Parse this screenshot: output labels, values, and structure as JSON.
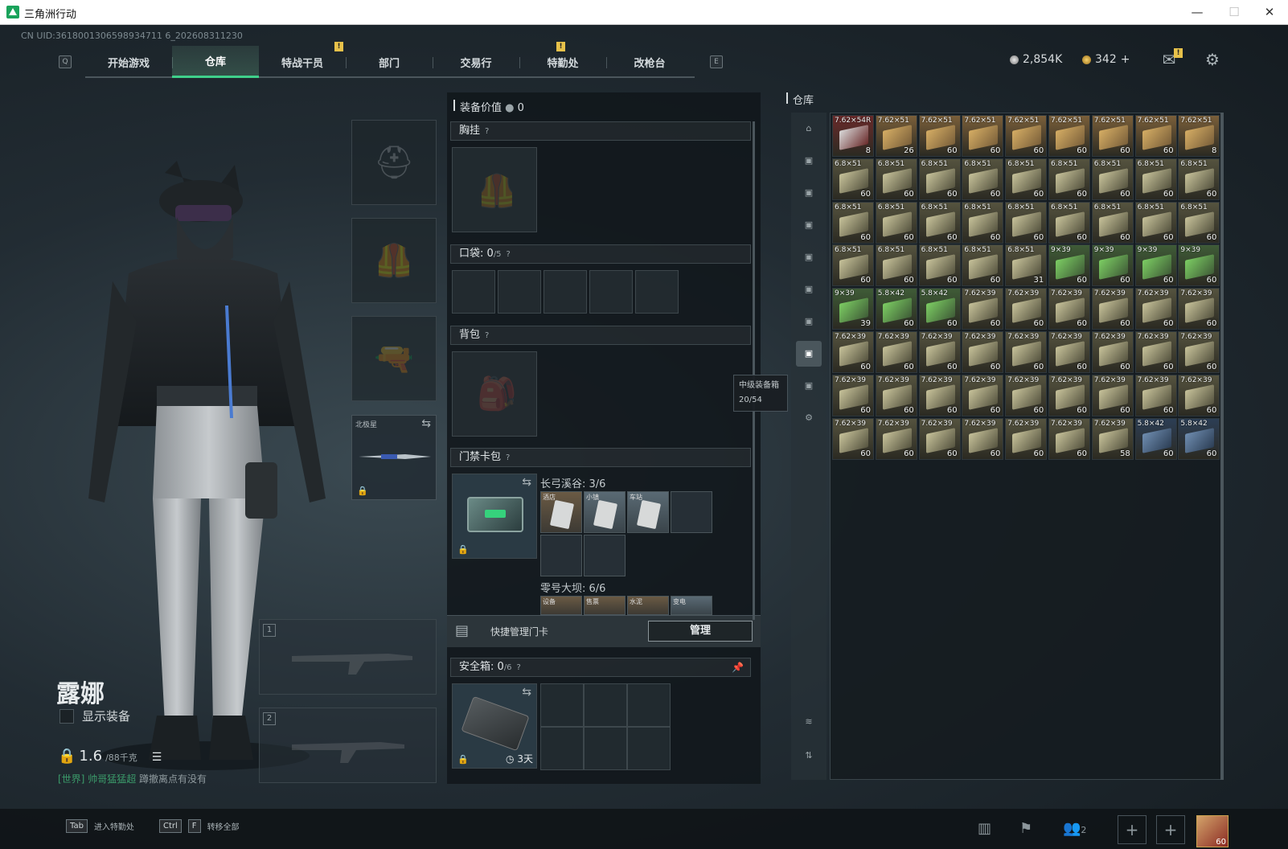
{
  "window": {
    "title": "三角洲行动",
    "minimize": "—",
    "maximize": "☐",
    "close": "✕"
  },
  "uid_text": "CN UID:3618001306598934711 6_202608311230",
  "nav": {
    "key_left": "Q",
    "key_right": "E",
    "tabs": [
      {
        "label": "开始游戏",
        "notif": ""
      },
      {
        "label": "仓库",
        "notif": ""
      },
      {
        "label": "特战干员",
        "notif": "!"
      },
      {
        "label": "部门",
        "notif": ""
      },
      {
        "label": "交易行",
        "notif": ""
      },
      {
        "label": "特勤处",
        "notif": "!"
      },
      {
        "label": "改枪台",
        "notif": ""
      }
    ],
    "active_tab": "仓库"
  },
  "currency": {
    "silver": "2,854K",
    "gold": "342",
    "add": "+",
    "mail_notif": "!"
  },
  "character": {
    "name": "露娜",
    "show_equipment": "显示装备",
    "weight": "1.6",
    "weight_max": "/88千克"
  },
  "chat": {
    "channel": "[世界]",
    "sender": "帅哥猛猛超",
    "message": "蹲撤离点有没有"
  },
  "equip": {
    "melee_label": "北极星",
    "weapon_slot_1": "1",
    "weapon_slot_2": "2"
  },
  "loadout": {
    "value_label": "装备价值",
    "value": "0",
    "chest_rig": "胸挂",
    "pockets": "口袋:",
    "pockets_count": "0",
    "pockets_max": "/5",
    "backpack": "背包",
    "keycard_case": "门禁卡包",
    "zone1_name": "长弓溪谷:",
    "zone1_count": "3/6",
    "zone1_cards": [
      "酒店",
      "小镇",
      "车站"
    ],
    "zone2_name": "零号大坝:",
    "zone2_count": "6/6",
    "zone2_cards": [
      "设备",
      "售票",
      "水泥",
      "变电"
    ],
    "quick_manage": "快捷管理门卡",
    "manage_btn": "管理",
    "safe_box": "安全箱:",
    "safe_count": "0",
    "safe_max": "/6",
    "safe_timer": "3天",
    "help": "?"
  },
  "tooltip": {
    "line1": "中级装备箱",
    "line2": "20/54"
  },
  "warehouse": {
    "title": "仓库",
    "items": [
      {
        "n": "7.62×54R",
        "c": "8",
        "t": "grey"
      },
      {
        "n": "7.62×51",
        "c": "26",
        "t": "tan"
      },
      {
        "n": "7.62×51",
        "c": "60",
        "t": "tan"
      },
      {
        "n": "7.62×51",
        "c": "60",
        "t": "tan"
      },
      {
        "n": "7.62×51",
        "c": "60",
        "t": "tan"
      },
      {
        "n": "7.62×51",
        "c": "60",
        "t": "tan"
      },
      {
        "n": "7.62×51",
        "c": "60",
        "t": "tan"
      },
      {
        "n": "7.62×51",
        "c": "60",
        "t": "tan"
      },
      {
        "n": "7.62×51",
        "c": "8",
        "t": "tan"
      },
      {
        "n": "6.8×51",
        "c": "60",
        "t": "olive"
      },
      {
        "n": "6.8×51",
        "c": "60",
        "t": "olive"
      },
      {
        "n": "6.8×51",
        "c": "60",
        "t": "olive"
      },
      {
        "n": "6.8×51",
        "c": "60",
        "t": "olive"
      },
      {
        "n": "6.8×51",
        "c": "60",
        "t": "olive"
      },
      {
        "n": "6.8×51",
        "c": "60",
        "t": "olive"
      },
      {
        "n": "6.8×51",
        "c": "60",
        "t": "olive"
      },
      {
        "n": "6.8×51",
        "c": "60",
        "t": "olive"
      },
      {
        "n": "6.8×51",
        "c": "60",
        "t": "olive"
      },
      {
        "n": "6.8×51",
        "c": "60",
        "t": "olive"
      },
      {
        "n": "6.8×51",
        "c": "60",
        "t": "olive"
      },
      {
        "n": "6.8×51",
        "c": "60",
        "t": "olive"
      },
      {
        "n": "6.8×51",
        "c": "60",
        "t": "olive"
      },
      {
        "n": "6.8×51",
        "c": "60",
        "t": "olive"
      },
      {
        "n": "6.8×51",
        "c": "60",
        "t": "olive"
      },
      {
        "n": "6.8×51",
        "c": "60",
        "t": "olive"
      },
      {
        "n": "6.8×51",
        "c": "60",
        "t": "olive"
      },
      {
        "n": "6.8×51",
        "c": "60",
        "t": "olive"
      },
      {
        "n": "6.8×51",
        "c": "60",
        "t": "olive"
      },
      {
        "n": "6.8×51",
        "c": "60",
        "t": "olive"
      },
      {
        "n": "6.8×51",
        "c": "60",
        "t": "olive"
      },
      {
        "n": "6.8×51",
        "c": "60",
        "t": "olive"
      },
      {
        "n": "6.8×51",
        "c": "31",
        "t": "olive"
      },
      {
        "n": "9×39",
        "c": "60",
        "t": "green"
      },
      {
        "n": "9×39",
        "c": "60",
        "t": "green"
      },
      {
        "n": "9×39",
        "c": "60",
        "t": "green"
      },
      {
        "n": "9×39",
        "c": "60",
        "t": "green"
      },
      {
        "n": "9×39",
        "c": "39",
        "t": "green"
      },
      {
        "n": "5.8×42",
        "c": "60",
        "t": "green"
      },
      {
        "n": "5.8×42",
        "c": "60",
        "t": "green"
      },
      {
        "n": "7.62×39",
        "c": "60",
        "t": "olive"
      },
      {
        "n": "7.62×39",
        "c": "60",
        "t": "olive"
      },
      {
        "n": "7.62×39",
        "c": "60",
        "t": "olive"
      },
      {
        "n": "7.62×39",
        "c": "60",
        "t": "olive"
      },
      {
        "n": "7.62×39",
        "c": "60",
        "t": "olive"
      },
      {
        "n": "7.62×39",
        "c": "60",
        "t": "olive"
      },
      {
        "n": "7.62×39",
        "c": "60",
        "t": "olive"
      },
      {
        "n": "7.62×39",
        "c": "60",
        "t": "olive"
      },
      {
        "n": "7.62×39",
        "c": "60",
        "t": "olive"
      },
      {
        "n": "7.62×39",
        "c": "60",
        "t": "olive"
      },
      {
        "n": "7.62×39",
        "c": "60",
        "t": "olive"
      },
      {
        "n": "7.62×39",
        "c": "60",
        "t": "olive"
      },
      {
        "n": "7.62×39",
        "c": "60",
        "t": "olive"
      },
      {
        "n": "7.62×39",
        "c": "60",
        "t": "olive"
      },
      {
        "n": "7.62×39",
        "c": "60",
        "t": "olive"
      },
      {
        "n": "7.62×39",
        "c": "60",
        "t": "olive"
      },
      {
        "n": "7.62×39",
        "c": "60",
        "t": "olive"
      },
      {
        "n": "7.62×39",
        "c": "60",
        "t": "olive"
      },
      {
        "n": "7.62×39",
        "c": "60",
        "t": "olive"
      },
      {
        "n": "7.62×39",
        "c": "60",
        "t": "olive"
      },
      {
        "n": "7.62×39",
        "c": "60",
        "t": "olive"
      },
      {
        "n": "7.62×39",
        "c": "60",
        "t": "olive"
      },
      {
        "n": "7.62×39",
        "c": "60",
        "t": "olive"
      },
      {
        "n": "7.62×39",
        "c": "60",
        "t": "olive"
      },
      {
        "n": "7.62×39",
        "c": "60",
        "t": "olive"
      },
      {
        "n": "7.62×39",
        "c": "60",
        "t": "olive"
      },
      {
        "n": "7.62×39",
        "c": "60",
        "t": "olive"
      },
      {
        "n": "7.62×39",
        "c": "60",
        "t": "olive"
      },
      {
        "n": "7.62×39",
        "c": "60",
        "t": "olive"
      },
      {
        "n": "7.62×39",
        "c": "60",
        "t": "olive"
      },
      {
        "n": "7.62×39",
        "c": "58",
        "t": "olive"
      },
      {
        "n": "5.8×42",
        "c": "60",
        "t": "blue"
      },
      {
        "n": "5.8×42",
        "c": "60",
        "t": "blue"
      }
    ]
  },
  "bottom": {
    "tab_key": "Tab",
    "tab_label": "进入特勤处",
    "ctrl_key": "Ctrl",
    "f_key": "F",
    "transfer_label": "转移全部",
    "friends_count": "2",
    "avatar_level": "60"
  },
  "colors": {
    "accent": "#3fd08a",
    "notif": "#e7c14a",
    "tan": "#c9a261",
    "olive": "#8f8f6b",
    "green": "#6fbf5a",
    "grey": "#c8c8c8",
    "blue": "#4b6a8f"
  }
}
